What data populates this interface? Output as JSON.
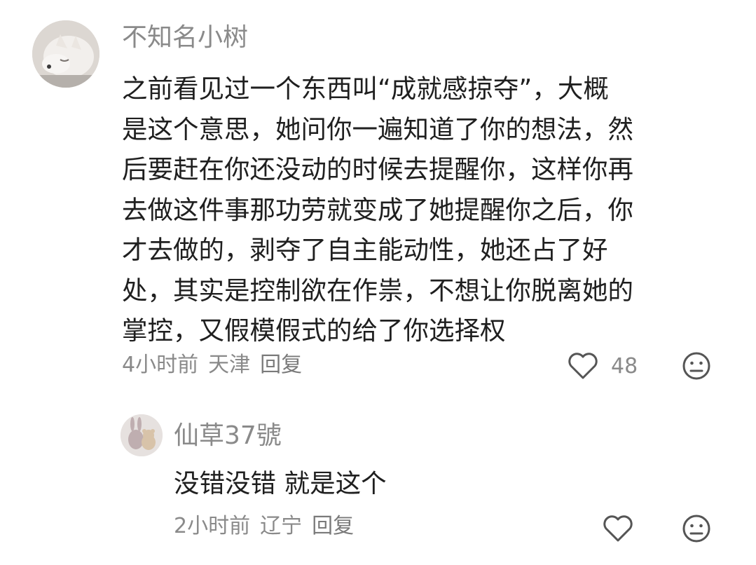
{
  "comments": [
    {
      "username": "不知名小树",
      "text_lines": [
        "之前看见过一个东西叫“成就感掠夺”，大概",
        "是这个意思，她问你一遍知道了你的想法，然",
        "后要赶在你还没动的时候去提醒你，这样你再",
        "去做这件事那功劳就变成了她提醒你之后，你",
        "才去做的，剥夺了自主能动性，她还占了好",
        "处，其实是控制欲在作祟，不想让你脱离她的",
        "掌控，又假模假式的给了你选择权"
      ],
      "time": "4小时前",
      "location": "天津",
      "reply_label": "回复",
      "like_count": "48",
      "avatar_icon": "dog-avatar",
      "like_icon": "heart-outline-icon",
      "dislike_icon": "neutral-face-icon"
    },
    {
      "username": "仙草37號",
      "text_lines": [
        "没错没错 就是这个"
      ],
      "time": "2小时前",
      "location": "辽宁",
      "reply_label": "回复",
      "avatar_icon": "plush-toys-avatar",
      "like_icon": "heart-outline-icon",
      "dislike_icon": "neutral-face-icon"
    }
  ],
  "colors": {
    "username": "#8a8a8a",
    "body": "#1f1f1f",
    "meta": "#8a8a8a",
    "icon": "#555555"
  }
}
